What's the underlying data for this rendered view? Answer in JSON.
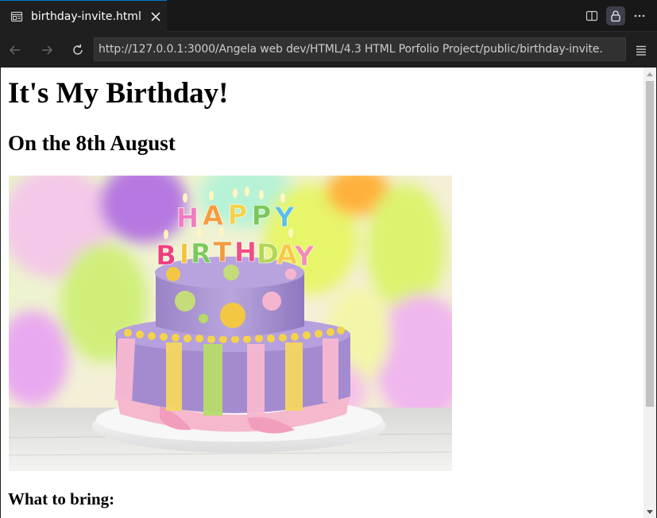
{
  "tab": {
    "title": "birthday-invite.html",
    "icon": "preview-icon",
    "close_icon": "close-icon"
  },
  "tab_actions": [
    {
      "name": "split-editor-icon"
    },
    {
      "name": "lock-icon"
    },
    {
      "name": "more-actions-icon"
    }
  ],
  "navigation": {
    "back_icon": "arrow-left-icon",
    "forward_icon": "arrow-right-icon",
    "reload_icon": "reload-icon",
    "url": "http://127.0.0.1:3000/Angela web dev/HTML/4.3 HTML Porfolio Project/public/birthday-invite.",
    "menu_icon": "hamburger-menu-icon"
  },
  "page": {
    "heading": "It's My Birthday!",
    "subheading": "On the 8th August",
    "image_alt": "Birthday cake",
    "section_heading": "What to bring:"
  },
  "colors": {
    "accent": "#0078d4",
    "chrome_bg": "#1f1f1f",
    "tabbar_bg": "#181818",
    "url_bg": "#313131"
  }
}
